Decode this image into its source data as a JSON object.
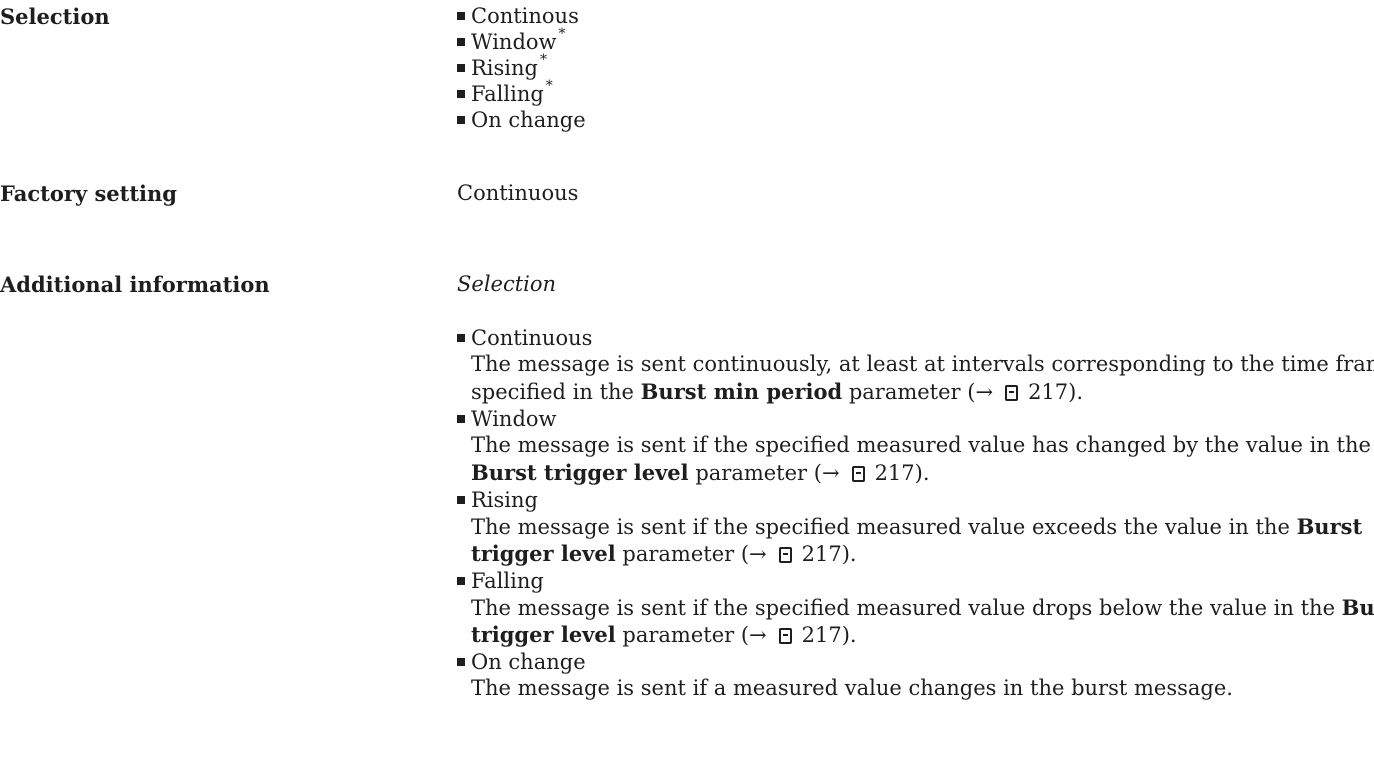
{
  "selection": {
    "label": "Selection",
    "options": [
      {
        "text": "Continous",
        "star": ""
      },
      {
        "text": "Window",
        "star": "*"
      },
      {
        "text": "Rising",
        "star": "*"
      },
      {
        "text": "Falling",
        "star": "*"
      },
      {
        "text": "On change",
        "star": ""
      }
    ]
  },
  "factory": {
    "label": "Factory setting",
    "value": "Continuous"
  },
  "additional": {
    "label": "Additional information",
    "subheading": "Selection",
    "items": [
      {
        "name": "Continuous",
        "line1": "The message is sent continuously, at least at intervals corresponding to the time frame",
        "line2_pre": "specified in the ",
        "line2_bold": "Burst min period",
        "line2_post": " parameter (→",
        "page": "217)."
      },
      {
        "name": "Window",
        "line1": "The message is sent if the specified measured value has changed by the value in the",
        "line2_bold": "Burst trigger level",
        "line2_post": " parameter (→",
        "page": "217)."
      },
      {
        "name": "Rising",
        "line1_pre": "The message is sent if the specified measured value exceeds the value in the ",
        "line1_bold": "Burst",
        "line2_bold": "trigger level",
        "line2_post": " parameter (→",
        "page": "217)."
      },
      {
        "name": "Falling",
        "line1_pre": "The message is sent if the specified measured value drops below the value in the ",
        "line1_bold": "Burst",
        "line2_bold": "trigger level",
        "line2_post": " parameter (→",
        "page": "217)."
      },
      {
        "name": "On change",
        "line1": "The message is sent if a measured value changes in the burst message."
      }
    ]
  },
  "icons": {
    "page_ref": "book-page-icon",
    "bullet": "square-bullet"
  }
}
